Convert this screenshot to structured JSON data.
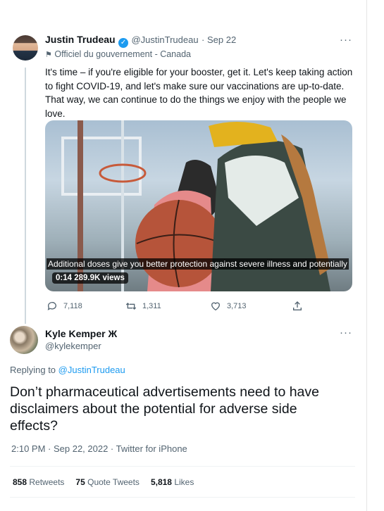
{
  "tweet": {
    "author_name": "Justin Trudeau",
    "handle": "@JustinTrudeau",
    "date": "· Sep 22",
    "label": "Officiel du gouvernement - Canada",
    "text": "It's time – if you're eligible for your booster, get it. Let's keep taking action to fight COVID-19, and let's make sure our vaccinations are up-to-date. That way, we can continue to do the things we enjoy with the people we love.",
    "video": {
      "caption": "Additional doses give you better protection against severe illness and potentially",
      "duration": "0:14",
      "views": "289.9K views"
    },
    "actions": {
      "replies": "7,118",
      "retweets": "1,311",
      "likes": "3,713"
    }
  },
  "reply": {
    "author_name": "Kyle Kemper Ж",
    "handle": "@kylekemper",
    "replying_prefix": "Replying to",
    "replying_to": "@JustinTrudeau",
    "text": "Don’t pharmaceutical advertisements need to have disclaimers about the potential for adverse side effects?",
    "meta": "2:10 PM · Sep 22, 2022 · Twitter for iPhone",
    "stats": {
      "retweets_count": "858",
      "retweets_label": "Retweets",
      "quotes_count": "75",
      "quotes_label": "Quote Tweets",
      "likes_count": "5,818",
      "likes_label": "Likes"
    }
  },
  "more_menu": "···",
  "colors": {
    "accent": "#1d9bf0",
    "muted": "#536471",
    "text": "#0f1419"
  }
}
